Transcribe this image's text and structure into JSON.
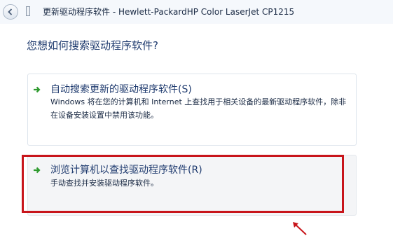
{
  "window": {
    "title": "更新驱动程序软件 - Hewlett-PackardHP Color LaserJet CP1215"
  },
  "question": "您想如何搜索驱动程序软件?",
  "options": [
    {
      "title": "自动搜索更新的驱动程序软件(S)",
      "description": "Windows 将在您的计算机和 Internet 上查找用于相关设备的最新驱动程序软件，除非在设备安装设置中禁用该功能。",
      "icon": "green-arrow-icon"
    },
    {
      "title": "浏览计算机以查找驱动程序软件(R)",
      "description": "手动查找并安装驱动程序软件。",
      "icon": "green-arrow-icon"
    }
  ],
  "colors": {
    "accent_text": "#1e3a6e",
    "arrow_green": "#2e9a2e",
    "highlight_red": "#c8151b"
  }
}
